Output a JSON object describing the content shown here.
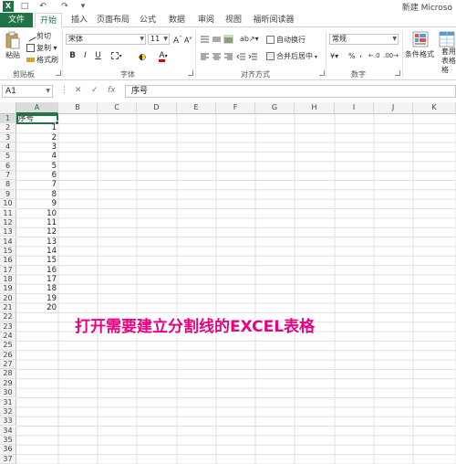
{
  "title_bar": {
    "title": "新建 Microso"
  },
  "tabs": [
    {
      "label": "文件"
    },
    {
      "label": "开始"
    },
    {
      "label": "插入"
    },
    {
      "label": "页面布局"
    },
    {
      "label": "公式"
    },
    {
      "label": "数据"
    },
    {
      "label": "审阅"
    },
    {
      "label": "视图"
    },
    {
      "label": "福昕阅读器"
    }
  ],
  "ribbon": {
    "clipboard": {
      "paste": "粘贴",
      "cut": "剪切",
      "copy": "复制 ▾",
      "format_painter": "格式刷",
      "label": "剪贴板"
    },
    "font": {
      "name": "宋体",
      "size": "11",
      "label": "字体",
      "bold": "B",
      "italic": "I",
      "underline": "U"
    },
    "alignment": {
      "wrap": "自动换行",
      "merge": "合并后居中",
      "label": "对齐方式"
    },
    "number": {
      "format": "常规",
      "label": "数字",
      "percent": "%",
      "comma": ","
    },
    "styles": {
      "conditional": "条件格式",
      "table": "套用\n表格格"
    }
  },
  "formula_bar": {
    "name_box": "A1",
    "fx": "fx",
    "content": "序号"
  },
  "columns": [
    "A",
    "B",
    "C",
    "D",
    "E",
    "F",
    "G",
    "H",
    "I",
    "J",
    "K"
  ],
  "rows": [
    "1",
    "2",
    "3",
    "4",
    "5",
    "6",
    "7",
    "8",
    "9",
    "10",
    "11",
    "12",
    "13",
    "14",
    "15",
    "16",
    "17",
    "18",
    "19",
    "20",
    "21",
    "22",
    "23",
    "24",
    "25",
    "26",
    "27",
    "28",
    "29",
    "30",
    "31",
    "32",
    "33",
    "34",
    "35",
    "36",
    "37"
  ],
  "cells": {
    "A1": "序号",
    "A": [
      "1",
      "2",
      "3",
      "4",
      "5",
      "6",
      "7",
      "8",
      "9",
      "10",
      "11",
      "12",
      "13",
      "14",
      "15",
      "16",
      "17",
      "18",
      "19",
      "20"
    ]
  },
  "caption": "打开需要建立分割线的EXCEL表格",
  "colors": {
    "accent": "#217346",
    "caption": "#e8007e"
  }
}
